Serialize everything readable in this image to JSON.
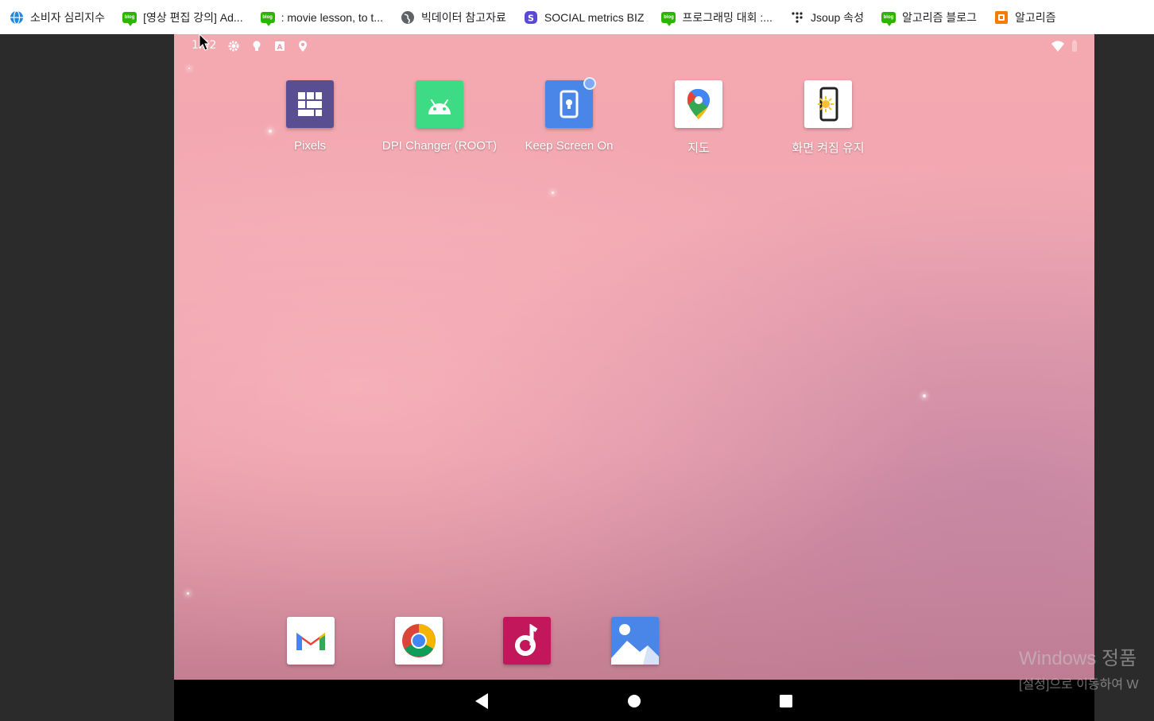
{
  "bookmarks": [
    {
      "label": "소비자 심리지수",
      "icon": "globe-blue-icon"
    },
    {
      "label": "[영상 편집 강의] Ad...",
      "icon": "blog-icon"
    },
    {
      "label": ": movie lesson, to t...",
      "icon": "blog-icon"
    },
    {
      "label": "빅데이터 참고자료",
      "icon": "globe-gray-icon"
    },
    {
      "label": "SOCIAL metrics BIZ",
      "icon": "social-s-icon"
    },
    {
      "label": "프로그래밍 대회 :...",
      "icon": "blog-icon"
    },
    {
      "label": "Jsoup 속성",
      "icon": "dots-icon"
    },
    {
      "label": "알고리즘 블로그",
      "icon": "blog-icon"
    },
    {
      "label": "알고리즘",
      "icon": "blogger-icon"
    }
  ],
  "status": {
    "clock": "1:52"
  },
  "apps": [
    {
      "label": "Pixels",
      "icon": "grid-icon",
      "color": "#5a4e93"
    },
    {
      "label": "DPI Changer (ROOT)",
      "icon": "android-icon",
      "color": "#3ddc84"
    },
    {
      "label": "Keep Screen On",
      "icon": "keep-screen-icon",
      "color": "#4a86e8"
    },
    {
      "label": "지도",
      "icon": "maps-pin-icon",
      "color": "#ffffff"
    },
    {
      "label": "화면 켜짐 유지",
      "icon": "phone-sun-icon",
      "color": "#ffffff"
    }
  ],
  "dock": [
    {
      "name": "gmail",
      "icon": "gmail-icon"
    },
    {
      "name": "chrome",
      "icon": "chrome-icon"
    },
    {
      "name": "music",
      "icon": "music-icon"
    },
    {
      "name": "gallery",
      "icon": "gallery-icon"
    }
  ],
  "watermark": {
    "line1": "Windows 정품",
    "line2": "[설정]으로 이동하여 W"
  }
}
